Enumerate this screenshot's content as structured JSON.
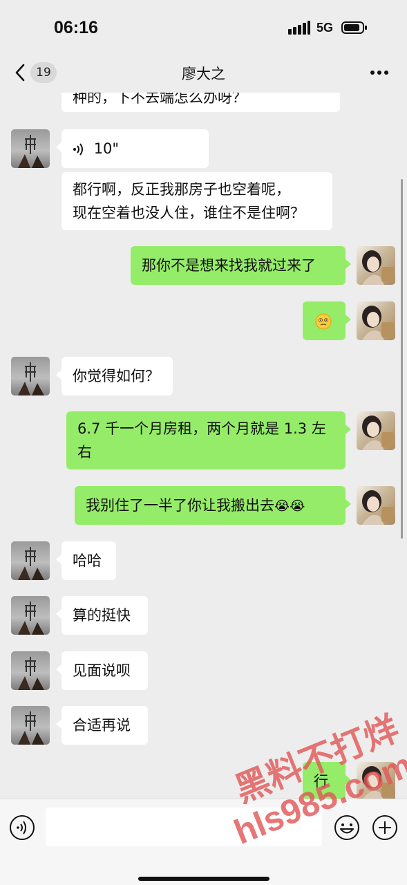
{
  "status_bar": {
    "time": "06:16",
    "network": "5G"
  },
  "nav": {
    "unread_count": "19",
    "title": "廖大之"
  },
  "messages": [
    {
      "side": "in",
      "text": "种的，下不去端怎么办呀？"
    },
    {
      "side": "in",
      "type": "voice",
      "duration": "10\""
    },
    {
      "side": "in",
      "lines": [
        "都行啊，反正我那房子也空着呢，",
        "现在空着也没人住，谁住不是住啊？"
      ]
    },
    {
      "side": "out",
      "text": "那你不是想来找我就过来了"
    },
    {
      "side": "out",
      "type": "emoji",
      "emoji": "🥴"
    },
    {
      "side": "in",
      "text": "你觉得如何？"
    },
    {
      "side": "out",
      "lines": [
        "6.7 千一个月房租，两个月就是 1.3 左",
        "右"
      ]
    },
    {
      "side": "out",
      "text": "我别住了一半了你让我搬出去",
      "emoji": "😭😭"
    },
    {
      "side": "in",
      "text": "哈哈"
    },
    {
      "side": "in",
      "text": "算的挺快"
    },
    {
      "side": "in",
      "text": "见面说呗"
    },
    {
      "side": "in",
      "text": "合适再说"
    },
    {
      "side": "out",
      "text": "行"
    }
  ],
  "input_bar": {
    "value": ""
  },
  "watermark": {
    "line1": "黑料不打烊",
    "line2": "hls985.com"
  },
  "colors": {
    "background": "#ededed",
    "incoming_bubble": "#ffffff",
    "outgoing_bubble": "#95ec69",
    "watermark": "#e25858"
  }
}
